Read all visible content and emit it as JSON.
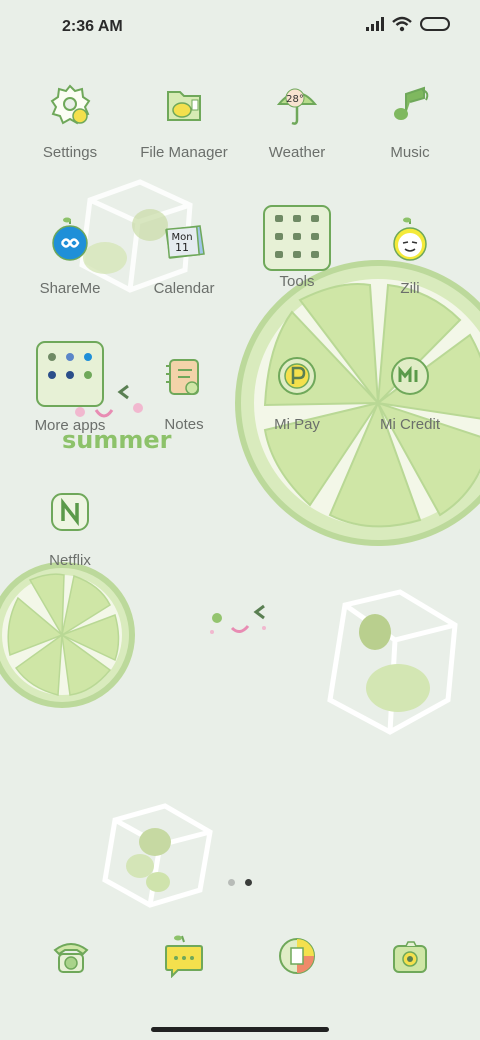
{
  "status_bar": {
    "time": "2:36 AM"
  },
  "apps": [
    {
      "label": "Settings",
      "icon": "settings-icon"
    },
    {
      "label": "File Manager",
      "icon": "folder-icon"
    },
    {
      "label": "Weather",
      "icon": "umbrella-icon",
      "badge": "28°"
    },
    {
      "label": "Music",
      "icon": "music-note-icon"
    },
    {
      "label": "ShareMe",
      "icon": "shareme-icon"
    },
    {
      "label": "Calendar",
      "icon": "calendar-icon",
      "month": "Mon",
      "day": "11"
    },
    {
      "label": "Tools",
      "icon": "tools-folder-icon"
    },
    {
      "label": "Zili",
      "icon": "zili-icon"
    },
    {
      "label": "More apps",
      "icon": "more-apps-folder-icon"
    },
    {
      "label": "Notes",
      "icon": "notes-icon"
    },
    {
      "label": "Mi Pay",
      "icon": "mi-pay-icon"
    },
    {
      "label": "Mi Credit",
      "icon": "mi-credit-icon"
    },
    {
      "label": "Netflix",
      "icon": "netflix-icon"
    }
  ],
  "wallpaper": {
    "text": "summer"
  },
  "dock": [
    {
      "icon": "phone-icon"
    },
    {
      "icon": "messages-icon"
    },
    {
      "icon": "browser-icon"
    },
    {
      "icon": "camera-icon"
    }
  ],
  "colors": {
    "background": "#e9efe8",
    "lime": "#cfe6a6",
    "lime_dark": "#8dc26a",
    "icon_stroke": "#6fa85a"
  }
}
